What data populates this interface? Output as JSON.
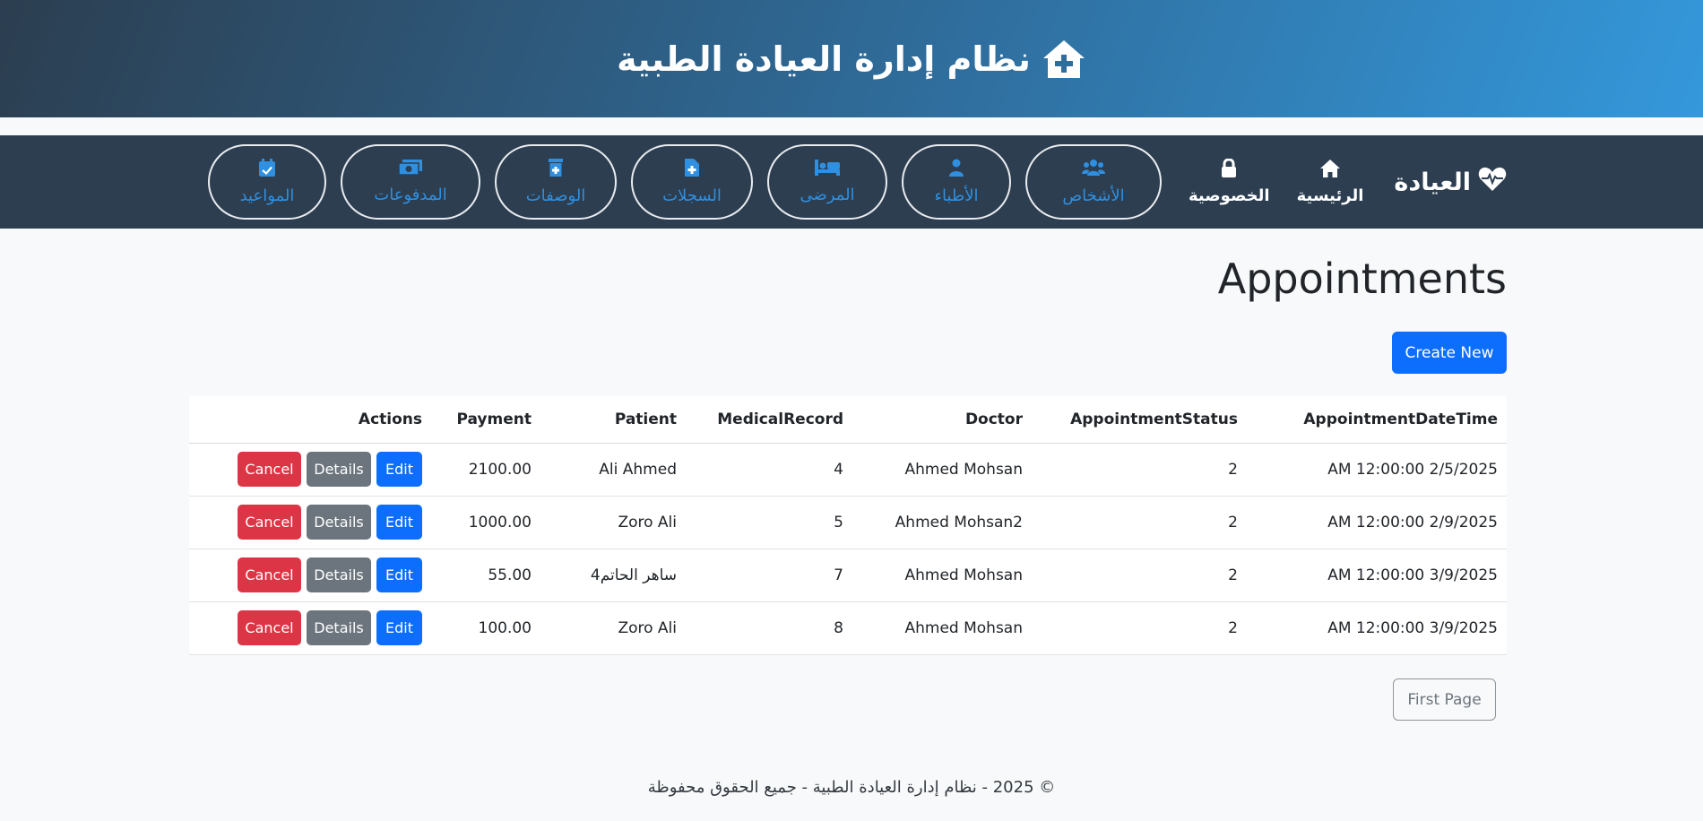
{
  "header": {
    "title": "نظام إدارة العيادة الطبية",
    "icon": "house-medical-icon"
  },
  "nav": {
    "brand": "العيادة",
    "brand_icon": "heart-pulse-icon",
    "plain_items": [
      {
        "label": "الرئيسية",
        "icon": "home-icon"
      },
      {
        "label": "الخصوصية",
        "icon": "lock-icon"
      }
    ],
    "pill_items": [
      {
        "label": "الأشخاص",
        "icon": "users-icon"
      },
      {
        "label": "الأطباء",
        "icon": "doctor-icon"
      },
      {
        "label": "المرضى",
        "icon": "bed-icon"
      },
      {
        "label": "السجلات",
        "icon": "file-medical-icon"
      },
      {
        "label": "الوصفات",
        "icon": "prescription-bottle-icon"
      },
      {
        "label": "المدفوعات",
        "icon": "money-icon"
      },
      {
        "label": "المواعيد",
        "icon": "calendar-check-icon"
      }
    ]
  },
  "page": {
    "title": "Appointments",
    "create_label": "Create New"
  },
  "table": {
    "headers": {
      "datetime": "AppointmentDateTime",
      "status": "AppointmentStatus",
      "doctor": "Doctor",
      "record": "MedicalRecord",
      "patient": "Patient",
      "payment": "Payment",
      "actions": "Actions"
    },
    "action_labels": {
      "edit": "Edit",
      "details": "Details",
      "cancel": "Cancel"
    },
    "rows": [
      {
        "datetime": "AM 12:00:00 2/5/2025",
        "status": "2",
        "doctor": "Ahmed Mohsan",
        "record": "4",
        "patient": "Ali Ahmed",
        "payment": "2100.00"
      },
      {
        "datetime": "AM 12:00:00 2/9/2025",
        "status": "2",
        "doctor": "Ahmed Mohsan2",
        "record": "5",
        "patient": "Zoro Ali",
        "payment": "1000.00"
      },
      {
        "datetime": "AM 12:00:00 3/9/2025",
        "status": "2",
        "doctor": "Ahmed Mohsan",
        "record": "7",
        "patient": "ساهر الحاتم4",
        "payment": "55.00"
      },
      {
        "datetime": "AM 12:00:00 3/9/2025",
        "status": "2",
        "doctor": "Ahmed Mohsan",
        "record": "8",
        "patient": "Zoro Ali",
        "payment": "100.00"
      }
    ]
  },
  "pagination": {
    "first_label": "First Page"
  },
  "footer": {
    "text": "© 2025 - نظام إدارة العيادة الطبية - جميع الحقوق محفوظة"
  },
  "colors": {
    "nav_bg": "#2c3e50",
    "primary": "#0d6efd",
    "danger": "#dc3545",
    "secondary": "#6c757d",
    "pill_text": "#2f8fe0"
  }
}
